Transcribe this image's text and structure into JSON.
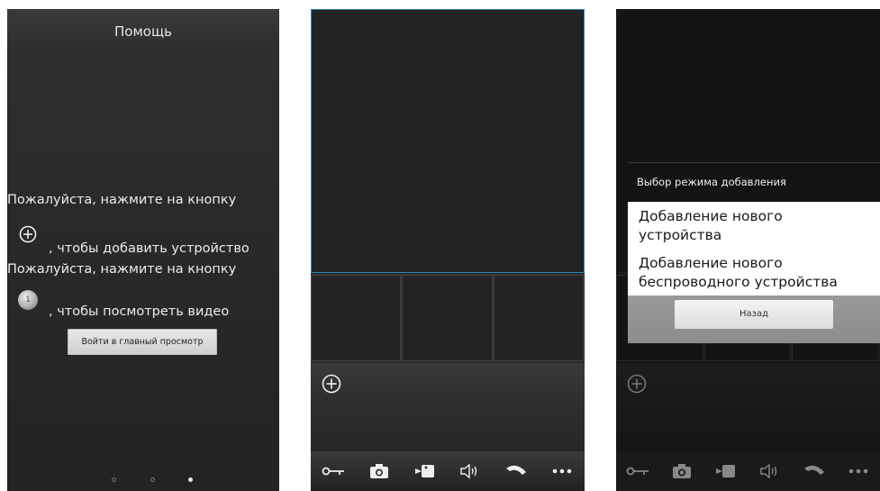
{
  "help_screen": {
    "title": "Помощь",
    "line1": "Пожалуйста, нажмите на кнопку",
    "line2": ", чтобы добавить устройство",
    "line3": "Пожалуйста, нажмите на кнопку",
    "line4": ", чтобы посмотреть видео",
    "dot_icon_number": "1",
    "enter_button": "Войти в главный просмотр",
    "pager_dots": 3,
    "pager_active_index": 2
  },
  "main_screen": {
    "toolbar_icons": [
      "key-icon",
      "camera-icon",
      "video-record-icon",
      "speaker-icon",
      "phone-icon",
      "more-icon"
    ],
    "accent_color": "#2c86b8"
  },
  "dialog_screen": {
    "dialog_title": "Выбор режима добавления",
    "options": [
      "Добавление нового устройства",
      "Добавление нового беспроводного устройства"
    ],
    "back_button": "Назад"
  }
}
